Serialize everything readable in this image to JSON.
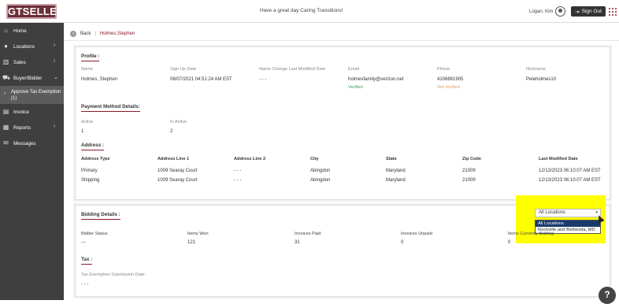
{
  "header": {
    "logo": "GTSELLER",
    "tagline": "Have a great day Caring Transitions!",
    "user": "Logan, Kim",
    "signout_label": "Sign Out"
  },
  "sidebar": {
    "items": [
      {
        "label": "Home",
        "icon": "home-icon"
      },
      {
        "label": "Locations",
        "icon": "location-pin-icon"
      },
      {
        "label": "Sales",
        "icon": "bar-chart-icon"
      },
      {
        "label": "Buyer/Bidder",
        "icon": "cart-icon"
      },
      {
        "label": "Approve Tax Exemption (1)",
        "icon": "chevron-right-icon"
      },
      {
        "label": "Invoice",
        "icon": "document-icon"
      },
      {
        "label": "Reports",
        "icon": "report-icon"
      },
      {
        "label": "Messages",
        "icon": "envelope-icon"
      }
    ]
  },
  "breadcrumb": {
    "back_label": "Back",
    "current": "Holmes,Stephen"
  },
  "profile": {
    "title": "Profile :",
    "labels": [
      "Name",
      "Sign Up Date",
      "Name Change Last Modified Date",
      "Email",
      "Phone",
      "Nickname"
    ],
    "values": [
      "Holmes, Stephen",
      "08/07/2021 04:51:24 AM EST",
      "- - -",
      "holmesfamily@verizon.net",
      "4106881905",
      "Peleholmes10"
    ],
    "email_status": "Verified",
    "phone_status": "Not Verified"
  },
  "payment": {
    "title": "Payment Method Details:",
    "labels": [
      "Active",
      "In Active"
    ],
    "values": [
      "1",
      "2"
    ]
  },
  "address": {
    "title": "Address :",
    "headers": [
      "Address Type",
      "Address Line 1",
      "Address Line 2",
      "City",
      "State",
      "Zip Code",
      "Last Modified Date"
    ],
    "rows": [
      [
        "Primary",
        "1009 Searay Court",
        "- - -",
        "Abingdon",
        "Maryland",
        "21009",
        "12/13/2023 06:10:07 AM EST"
      ],
      [
        "Shipping",
        "1009 Searay Court",
        "- - -",
        "Abingdon",
        "Maryland",
        "21009",
        "12/13/2023 06:10:07 AM EST"
      ]
    ]
  },
  "bidding": {
    "title": "Bidding Details :",
    "labels": [
      "Bidder Status",
      "Items Won",
      "Invoices Paid",
      "Invoices Unpaid",
      "Items Currently Bidding"
    ],
    "values": [
      "---",
      "121",
      "31",
      "0",
      "0"
    ],
    "location_select": "All Locations",
    "location_options": [
      "All Locations",
      "Rockville and Bethesda, MD"
    ]
  },
  "tax": {
    "title": "Tax :",
    "label": "Tax Exemption Submission Date:",
    "value": "- - -"
  },
  "help_label": "?"
}
